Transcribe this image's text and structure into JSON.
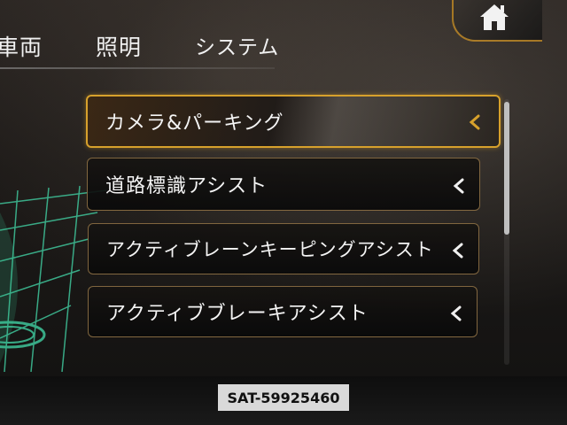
{
  "tabs": [
    "車両",
    "照明",
    "システム"
  ],
  "menu": [
    {
      "label": "カメラ&パーキング",
      "selected": true
    },
    {
      "label": "道路標識アシスト",
      "selected": false
    },
    {
      "label": "アクティブレーンキーピングアシスト",
      "selected": false
    },
    {
      "label": "アクティブブレーキアシスト",
      "selected": false
    }
  ],
  "overlay_label": "SAT-59925460",
  "colors": {
    "accent": "#d7a12c",
    "text": "#f4f4f4",
    "background": "#1d1a18"
  },
  "icons": {
    "home": "home-icon",
    "chevron": "chevron-left-icon"
  }
}
